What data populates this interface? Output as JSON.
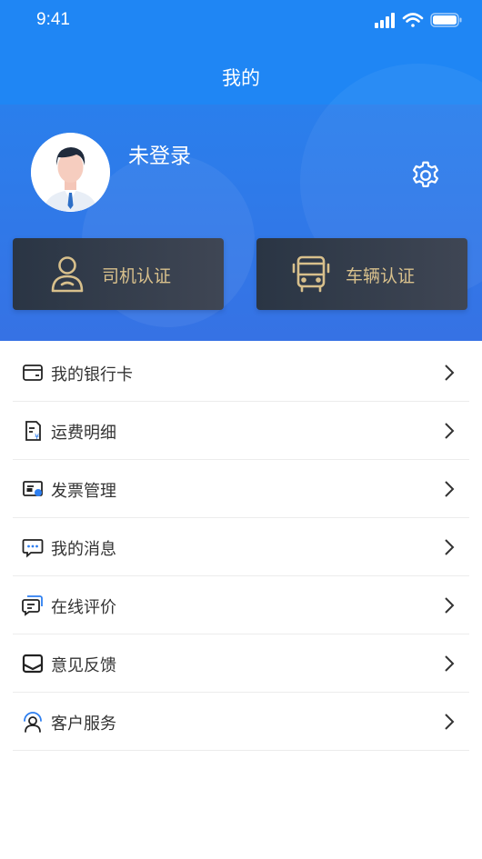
{
  "status_bar": {
    "time": "9:41",
    "icons": [
      "signal-icon",
      "wifi-icon",
      "battery-icon"
    ]
  },
  "header": {
    "title": "我的"
  },
  "profile": {
    "name": "未登录",
    "avatar": "user-avatar",
    "settings_icon": "gear-icon"
  },
  "certifications": [
    {
      "label": "司机认证",
      "icon": "driver-icon"
    },
    {
      "label": "车辆认证",
      "icon": "bus-icon"
    }
  ],
  "menu": [
    {
      "label": "我的银行卡",
      "icon": "bank-card-icon"
    },
    {
      "label": "运费明细",
      "icon": "freight-detail-icon"
    },
    {
      "label": "发票管理",
      "icon": "invoice-icon"
    },
    {
      "label": "我的消息",
      "icon": "message-icon"
    },
    {
      "label": "在线评价",
      "icon": "review-icon"
    },
    {
      "label": "意见反馈",
      "icon": "feedback-icon"
    },
    {
      "label": "客户服务",
      "icon": "customer-service-icon"
    }
  ],
  "colors": {
    "primary": "#1f86f4",
    "gold": "#d8c08c",
    "dark_button": "#333c4a"
  }
}
